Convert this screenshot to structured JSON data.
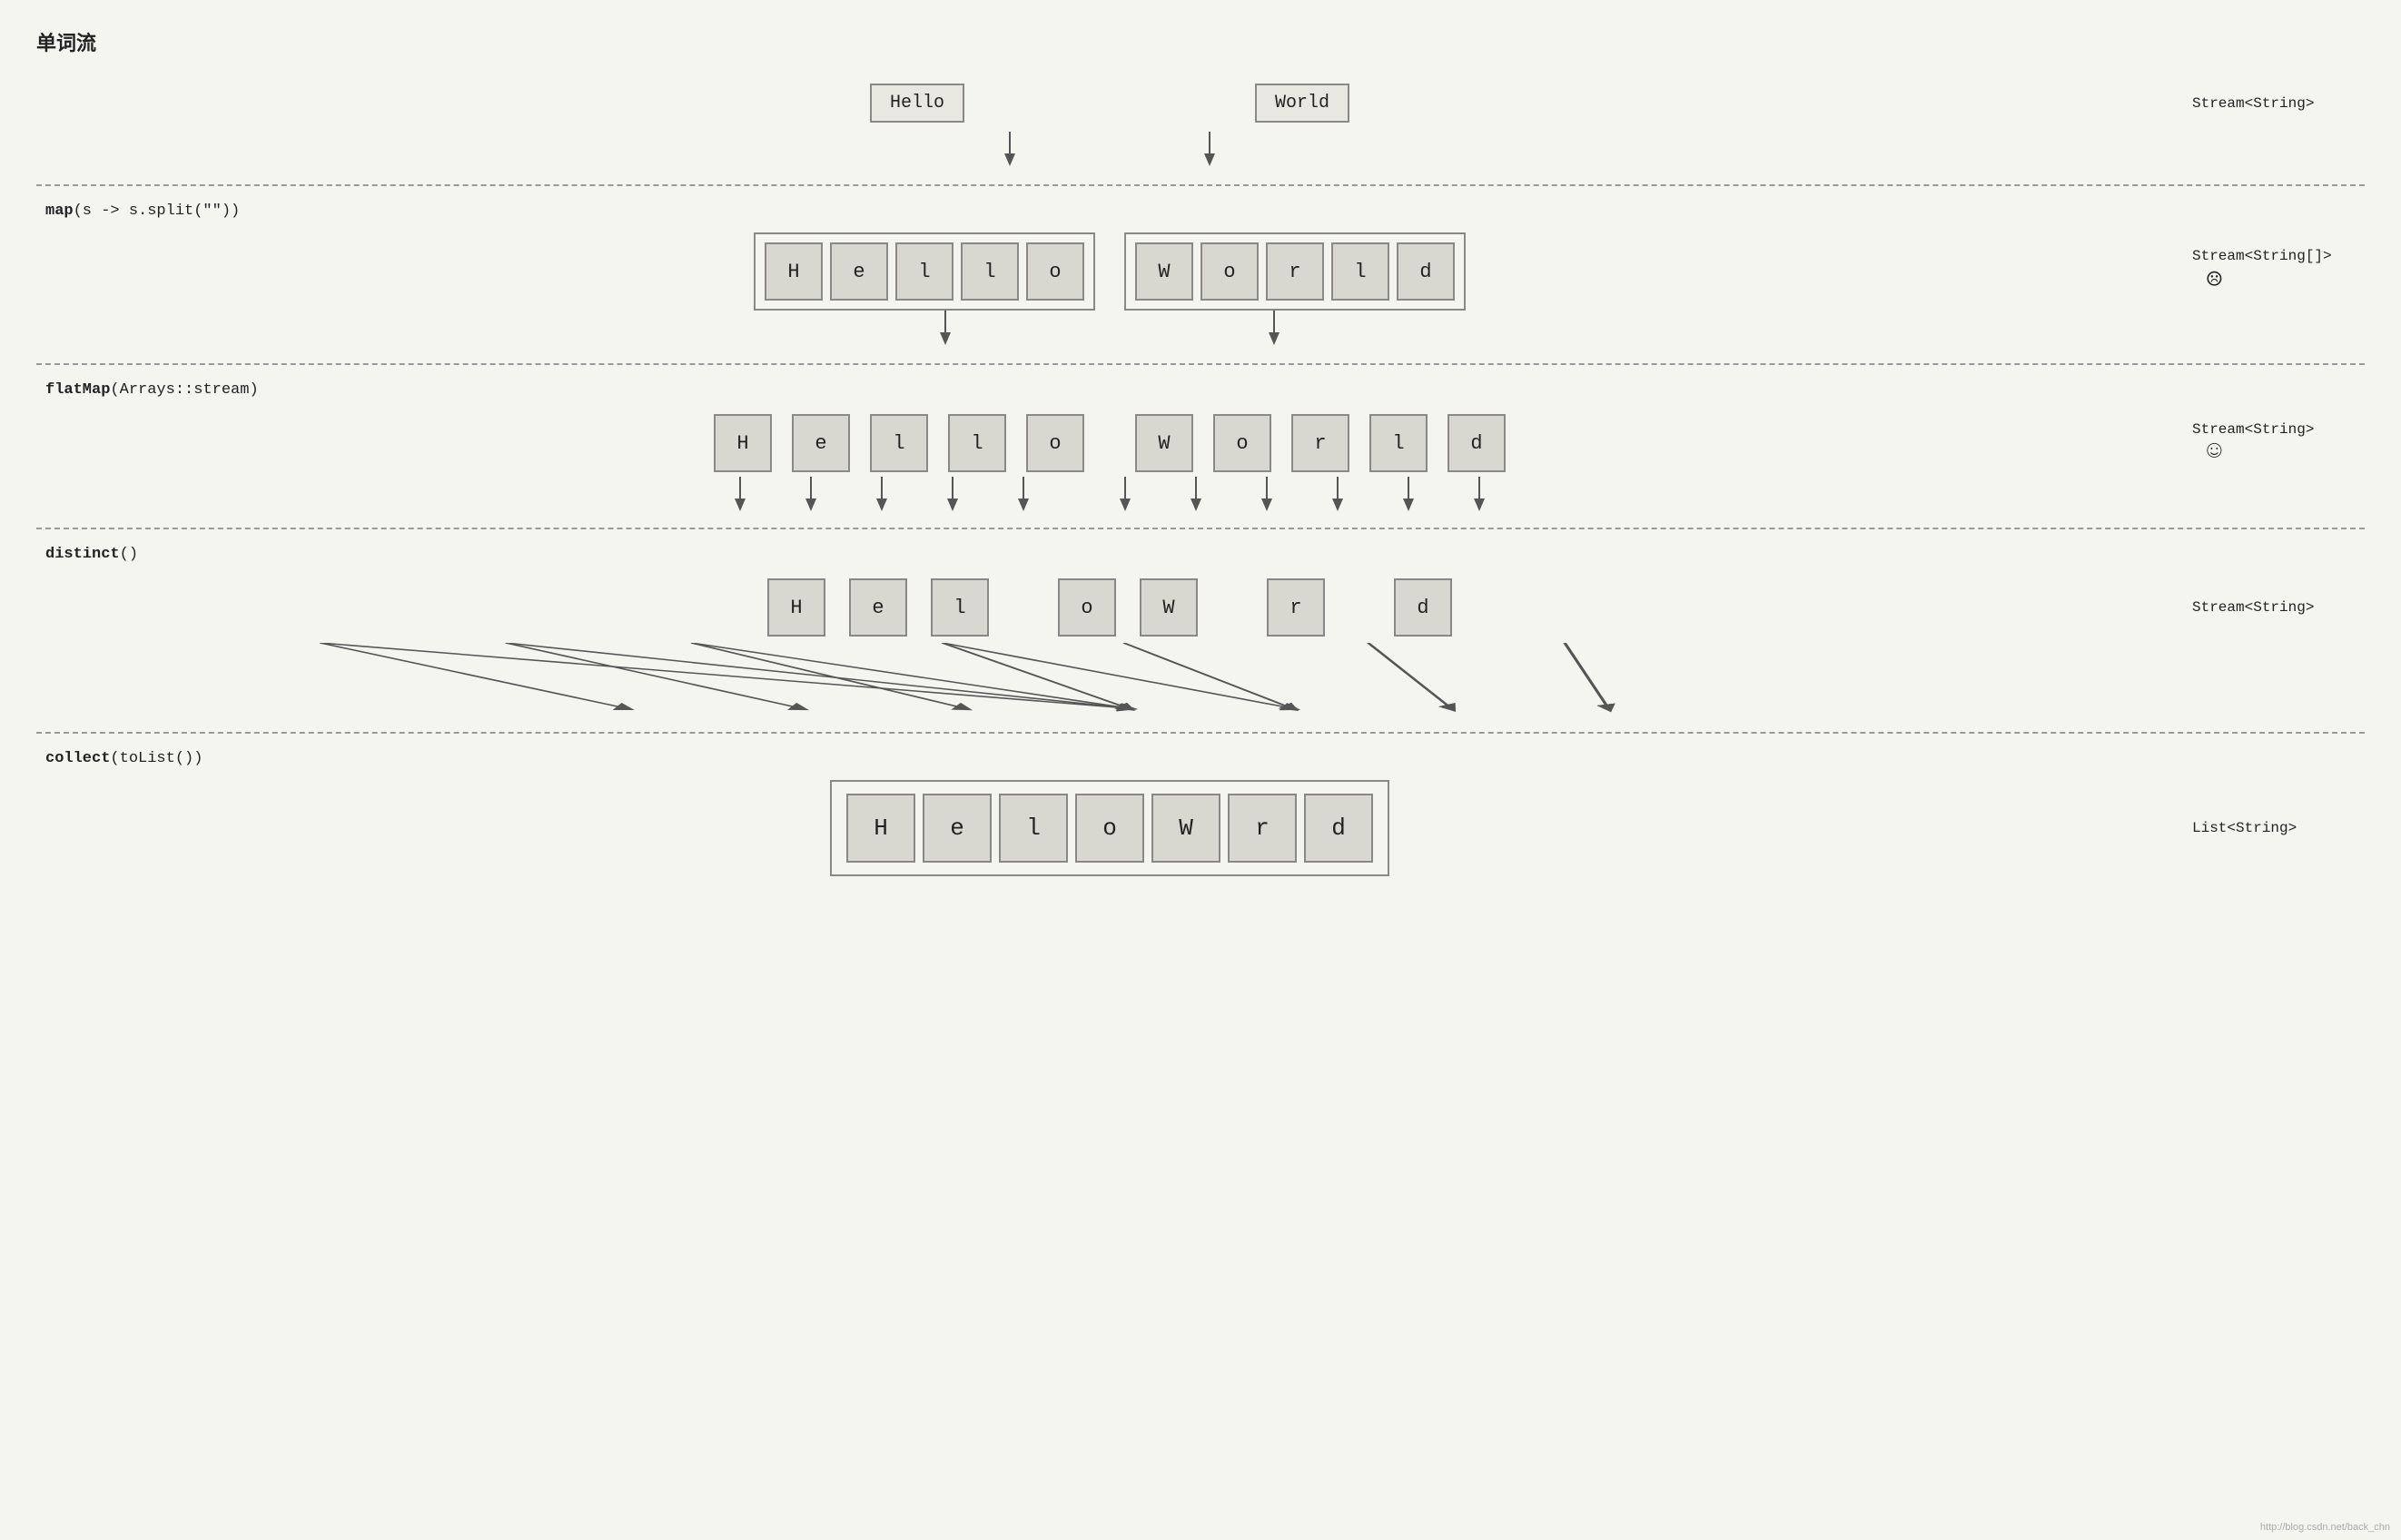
{
  "title": "单词流",
  "sections": {
    "top": {
      "words": [
        "Hello",
        "World"
      ],
      "label": "Stream<String>"
    },
    "map": {
      "operation": "map",
      "operation_arg": "(s -> s.split(\"\"))",
      "hello_letters": [
        "H",
        "e",
        "l",
        "l",
        "o"
      ],
      "world_letters": [
        "W",
        "o",
        "r",
        "l",
        "d"
      ],
      "label": "Stream<String[]>",
      "emoji": "☹"
    },
    "flatmap": {
      "operation": "flatMap",
      "operation_arg": "(Arrays::stream)",
      "hello_letters": [
        "H",
        "e",
        "l",
        "l",
        "o"
      ],
      "world_letters": [
        "W",
        "o",
        "r",
        "l",
        "d"
      ],
      "label": "Stream<String>",
      "emoji": "☺"
    },
    "distinct": {
      "operation": "distinct",
      "operation_arg": "()",
      "letters": [
        "H",
        "e",
        "l",
        "o",
        "W",
        "r",
        "d"
      ],
      "label": "Stream<String>"
    },
    "collect": {
      "operation": "collect",
      "operation_arg": "(toList())",
      "letters": [
        "H",
        "e",
        "l",
        "o",
        "W",
        "r",
        "d"
      ],
      "label": "List<String>"
    }
  },
  "watermark": "http://blog.csdn.net/back_chn"
}
